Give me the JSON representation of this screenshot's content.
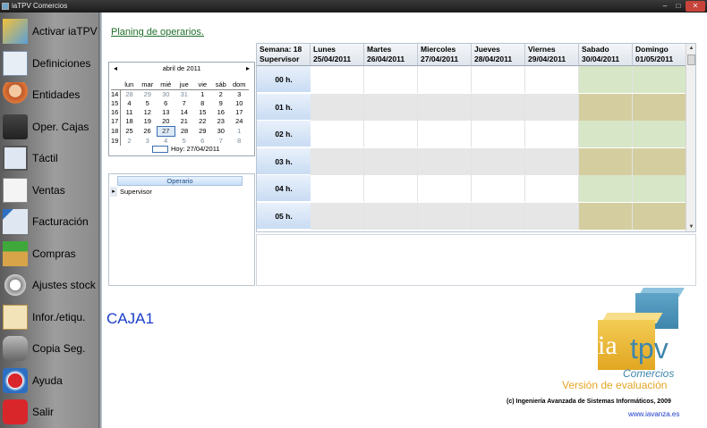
{
  "window": {
    "title": "iaTPV Comercios",
    "minimize": "–",
    "maximize": "□",
    "close": "✕"
  },
  "sidebar": {
    "items": [
      {
        "label": "Activar iaTPV",
        "icon": "activate-icon"
      },
      {
        "label": "Definiciones",
        "icon": "definitions-icon"
      },
      {
        "label": "Entidades",
        "icon": "entities-icon"
      },
      {
        "label": "Oper. Cajas",
        "icon": "cash-register-icon"
      },
      {
        "label": "Táctil",
        "icon": "touch-screen-icon"
      },
      {
        "label": "Ventas",
        "icon": "sales-icon"
      },
      {
        "label": "Facturación",
        "icon": "invoice-icon"
      },
      {
        "label": "Compras",
        "icon": "purchases-icon"
      },
      {
        "label": "Ajustes stock",
        "icon": "stock-adjust-icon"
      },
      {
        "label": "Infor./etiqu.",
        "icon": "report-icon"
      },
      {
        "label": "Copia Seg.",
        "icon": "backup-icon"
      },
      {
        "label": "Ayuda",
        "icon": "help-icon"
      },
      {
        "label": "Salir",
        "icon": "power-icon"
      }
    ]
  },
  "main": {
    "planing_link": "Planing de operarios.",
    "calendar": {
      "month_label": "abril de 2011",
      "prev": "◂",
      "next": "▸",
      "dow": [
        "lun",
        "mar",
        "mié",
        "jue",
        "vie",
        "sáb",
        "dom"
      ],
      "weeks": [
        {
          "wk": "14",
          "days": [
            "28",
            "29",
            "30",
            "31",
            "1",
            "2",
            "3"
          ],
          "other": [
            true,
            true,
            true,
            true,
            false,
            false,
            false
          ]
        },
        {
          "wk": "15",
          "days": [
            "4",
            "5",
            "6",
            "7",
            "8",
            "9",
            "10"
          ],
          "other": [
            false,
            false,
            false,
            false,
            false,
            false,
            false
          ]
        },
        {
          "wk": "16",
          "days": [
            "11",
            "12",
            "13",
            "14",
            "15",
            "16",
            "17"
          ],
          "other": [
            false,
            false,
            false,
            false,
            false,
            false,
            false
          ]
        },
        {
          "wk": "17",
          "days": [
            "18",
            "19",
            "20",
            "21",
            "22",
            "23",
            "24"
          ],
          "other": [
            false,
            false,
            false,
            false,
            false,
            false,
            false
          ]
        },
        {
          "wk": "18",
          "days": [
            "25",
            "26",
            "27",
            "28",
            "29",
            "30",
            "1"
          ],
          "other": [
            false,
            false,
            false,
            false,
            false,
            false,
            true
          ]
        },
        {
          "wk": "19",
          "days": [
            "2",
            "3",
            "4",
            "5",
            "6",
            "7",
            "8"
          ],
          "other": [
            true,
            true,
            true,
            true,
            true,
            true,
            true
          ]
        }
      ],
      "selected": "27",
      "today_label": "Hoy: 27/04/2011"
    },
    "operario": {
      "header": "Operario",
      "rows": [
        "Supervisor"
      ]
    },
    "caja": "CAJA1",
    "schedule": {
      "corner": [
        "Semana: 18",
        "Supervisor"
      ],
      "days": [
        {
          "name": "Lunes",
          "date": "25/04/2011"
        },
        {
          "name": "Martes",
          "date": "26/04/2011"
        },
        {
          "name": "Miercoles",
          "date": "27/04/2011"
        },
        {
          "name": "Jueves",
          "date": "28/04/2011"
        },
        {
          "name": "Viernes",
          "date": "29/04/2011"
        },
        {
          "name": "Sabado",
          "date": "30/04/2011"
        },
        {
          "name": "Domingo",
          "date": "01/05/2011"
        }
      ],
      "hours": [
        "00 h.",
        "01 h.",
        "02 h.",
        "03 h.",
        "04 h.",
        "05 h."
      ],
      "colors": {
        "weekday_light": "#ffffff",
        "weekday_dark": "#e6e6e6",
        "weekend_light": "#d8e6c8",
        "weekend_dark": "#d4cda0"
      }
    }
  },
  "branding": {
    "ia": "ia",
    "tpv": "tpv",
    "comercios": "Comercios",
    "evaluation": "Versión de evaluación",
    "copyright": "(c) Ingeniería Avanzada de Sistemas Informáticos, 2009",
    "website": "www.iavanza.es"
  }
}
